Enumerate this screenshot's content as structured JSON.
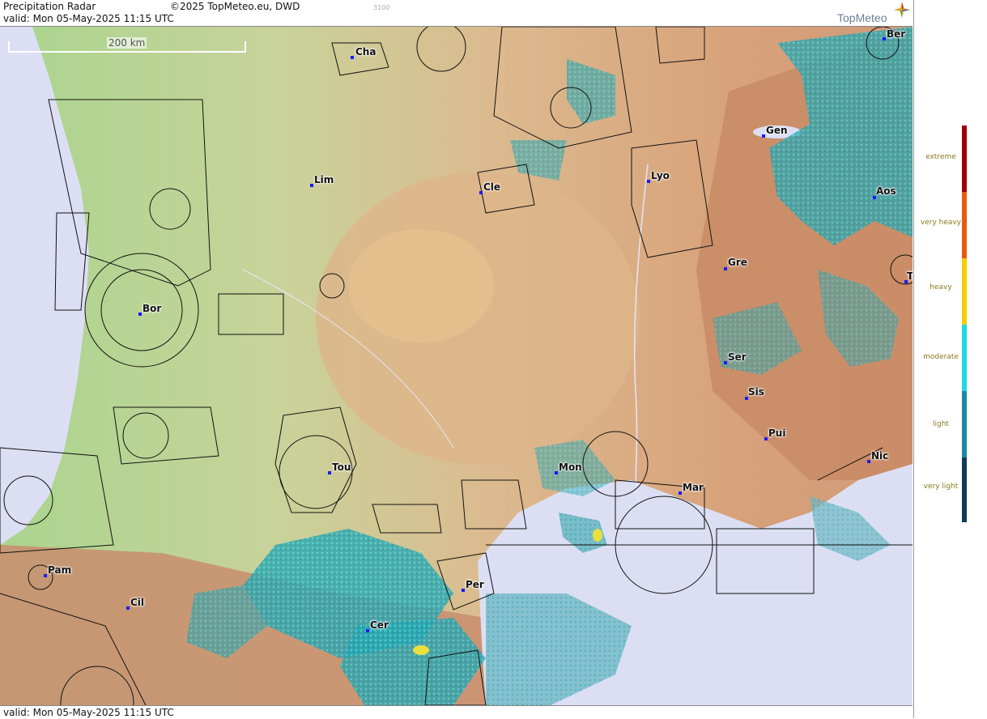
{
  "header": {
    "title": "Precipitation Radar",
    "copyright": "©2025 TopMeteo.eu, DWD",
    "valid": "valid:  Mon  05-May-2025 11:15 UTC",
    "code": "3100",
    "logo": "TopMeteo"
  },
  "footer": {
    "valid": "valid:  Mon  05-May-2025 11:15 UTC"
  },
  "scale_label": "200 km",
  "legend": {
    "levels": [
      {
        "label": "extreme",
        "color": "#a00000"
      },
      {
        "label": "very heavy",
        "color": "#e85a10"
      },
      {
        "label": "heavy",
        "color": "#f2d000"
      },
      {
        "label": "moderate",
        "color": "#22d8e0"
      },
      {
        "label": "light",
        "color": "#1a8aa0"
      },
      {
        "label": "very light",
        "color": "#0c3c5a"
      }
    ]
  },
  "cities": {
    "cha": "Cha",
    "ber": "Ber",
    "gen": "Gen",
    "lim": "Lim",
    "cle": "Cle",
    "lyo": "Lyo",
    "aos": "Aos",
    "gre": "Gre",
    "bor": "Bor",
    "ser": "Ser",
    "sis": "Sis",
    "pui": "Pui",
    "tou": "Tou",
    "mon": "Mon",
    "nic": "Nic",
    "mar": "Mar",
    "pam": "Pam",
    "cil": "Cil",
    "per": "Per",
    "cer": "Cer",
    "tur": "T"
  }
}
